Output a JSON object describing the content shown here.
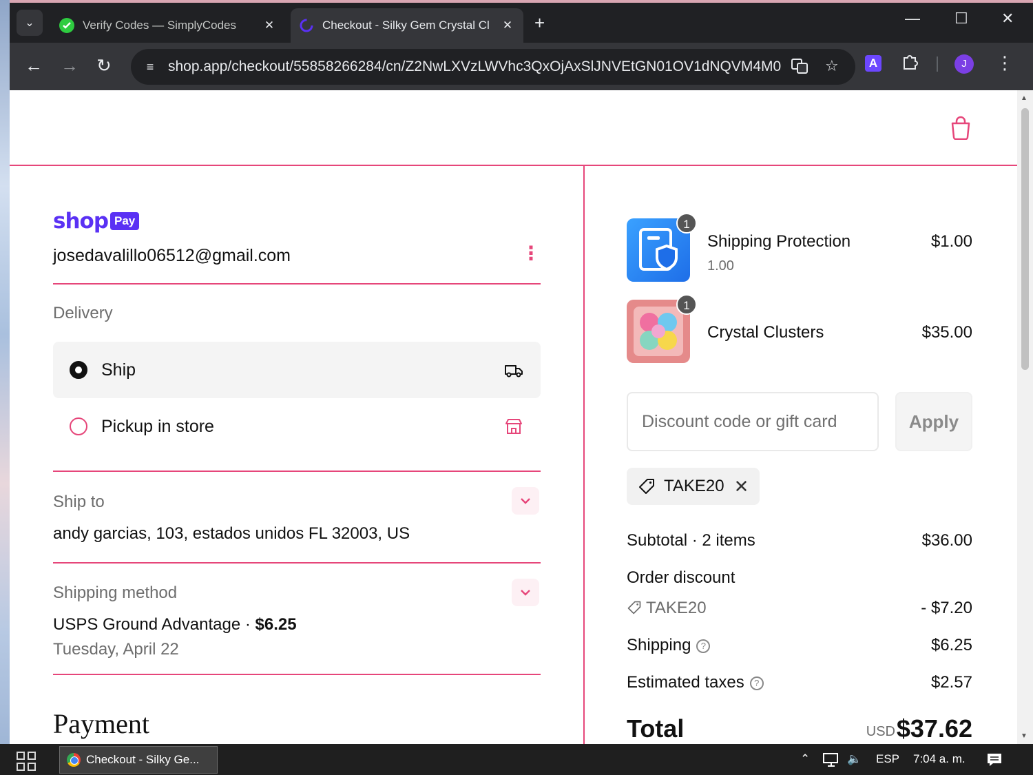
{
  "browser": {
    "tabs": [
      {
        "title": "Verify Codes — SimplyCodes",
        "active": false
      },
      {
        "title": "Checkout - Silky Gem Crystal Cl",
        "active": true
      }
    ],
    "url": "shop.app/checkout/55858266284/cn/Z2NwLXVzLWVhc3QxOjAxSlJNVEtGN01OV1dNQVM4M0Z...",
    "profile_initial": "J",
    "extension_label": "A"
  },
  "left": {
    "shop_logo": {
      "word": "shop",
      "badge": "Pay"
    },
    "email": "josedavalillo06512@gmail.com",
    "delivery": {
      "label": "Delivery",
      "options": [
        {
          "label": "Ship",
          "selected": true
        },
        {
          "label": "Pickup in store",
          "selected": false
        }
      ]
    },
    "ship_to": {
      "label": "Ship to",
      "address": "andy garcias, 103, estados unidos FL 32003, US"
    },
    "shipping_method": {
      "label": "Shipping method",
      "name": "USPS Ground Advantage · ",
      "price": "$6.25",
      "date": "Tuesday, April 22"
    },
    "payment_heading": "Payment"
  },
  "cart": {
    "items": [
      {
        "name": "Shipping Protection",
        "sub": "1.00",
        "price": "$1.00",
        "qty": "1"
      },
      {
        "name": "Crystal Clusters",
        "sub": "",
        "price": "$35.00",
        "qty": "1"
      }
    ],
    "discount_placeholder": "Discount code or gift card",
    "apply_label": "Apply",
    "applied_code": "TAKE20",
    "summary": {
      "subtotal_label": "Subtotal · 2 items",
      "subtotal": "$36.00",
      "order_discount_label": "Order discount",
      "discount_code": "TAKE20",
      "discount_amount": "- $7.20",
      "shipping_label": "Shipping",
      "shipping": "$6.25",
      "taxes_label": "Estimated taxes",
      "taxes": "$2.57",
      "total_label": "Total",
      "currency": "USD",
      "total": "$37.62"
    }
  },
  "taskbar": {
    "task_label": "Checkout - Silky Ge...",
    "language": "ESP",
    "time": "7:04 a. m."
  },
  "colors": {
    "accent": "#e6467a",
    "shop_purple": "#5a31f4",
    "chrome_dark": "#202124",
    "chrome_toolbar": "#35363a"
  }
}
